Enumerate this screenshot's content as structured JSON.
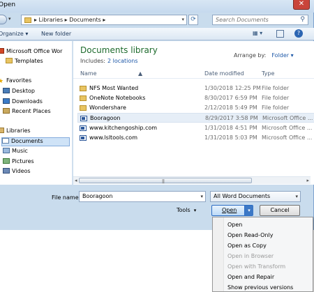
{
  "window": {
    "title": "Open",
    "close_glyph": "✕"
  },
  "address": {
    "crumbs": "▸ Libraries ▸ Documents ▸",
    "search_placeholder": "Search Documents"
  },
  "toolbar": {
    "organize": "Organize ▾",
    "new_folder": "New folder"
  },
  "nav": {
    "items": [
      {
        "label": "Microsoft Office Wor",
        "icon": "office-icon"
      },
      {
        "label": "Templates",
        "icon": "folder-icon"
      },
      {
        "label": "Favorites",
        "icon": "star-icon"
      },
      {
        "label": "Desktop",
        "icon": "desktop-icon"
      },
      {
        "label": "Downloads",
        "icon": "downloads-icon"
      },
      {
        "label": "Recent Places",
        "icon": "recent-places-icon"
      },
      {
        "label": "Libraries",
        "icon": "libraries-icon"
      },
      {
        "label": "Documents",
        "icon": "documents-icon"
      },
      {
        "label": "Music",
        "icon": "music-icon"
      },
      {
        "label": "Pictures",
        "icon": "pictures-icon"
      },
      {
        "label": "Videos",
        "icon": "videos-icon"
      }
    ]
  },
  "library": {
    "title": "Documents library",
    "includes_label": "Includes:",
    "includes_link": "2 locations",
    "arrange_label": "Arrange by:",
    "arrange_value": "Folder ▾"
  },
  "columns": {
    "name": "Name",
    "date": "Date modified",
    "type": "Type"
  },
  "files": [
    {
      "name": "NFS Most Wanted",
      "date": "1/30/2018 12:25 PM",
      "type": "File folder",
      "icon": "folder-icon"
    },
    {
      "name": "OneNote Notebooks",
      "date": "8/30/2017 6:59 PM",
      "type": "File folder",
      "icon": "folder-icon"
    },
    {
      "name": "Wondershare",
      "date": "2/12/2018 5:49 PM",
      "type": "File folder",
      "icon": "folder-icon"
    },
    {
      "name": "Booragoon",
      "date": "8/29/2017 3:58 PM",
      "type": "Microsoft Office ...",
      "icon": "word-document-icon"
    },
    {
      "name": "www.kitchengoship.com",
      "date": "1/31/2018 4:51 PM",
      "type": "Microsoft Office ...",
      "icon": "word-document-icon"
    },
    {
      "name": "www.lsltools.com",
      "date": "1/31/2018 5:03 PM",
      "type": "Microsoft Office ...",
      "icon": "word-document-icon"
    }
  ],
  "footer": {
    "file_name_label": "File name:",
    "file_name_value": "Booragoon",
    "filter_value": "All Word Documents",
    "tools_label": "Tools",
    "open_label": "Open",
    "cancel_label": "Cancel"
  },
  "open_menu": {
    "items": [
      {
        "label": "Open",
        "enabled": true
      },
      {
        "label": "Open Read-Only",
        "enabled": true
      },
      {
        "label": "Open as Copy",
        "enabled": true
      },
      {
        "label": "Open in Browser",
        "enabled": false
      },
      {
        "label": "Open with Transform",
        "enabled": false
      },
      {
        "label": "Open and Repair",
        "enabled": true
      },
      {
        "label": "Show previous versions",
        "enabled": true
      }
    ]
  }
}
